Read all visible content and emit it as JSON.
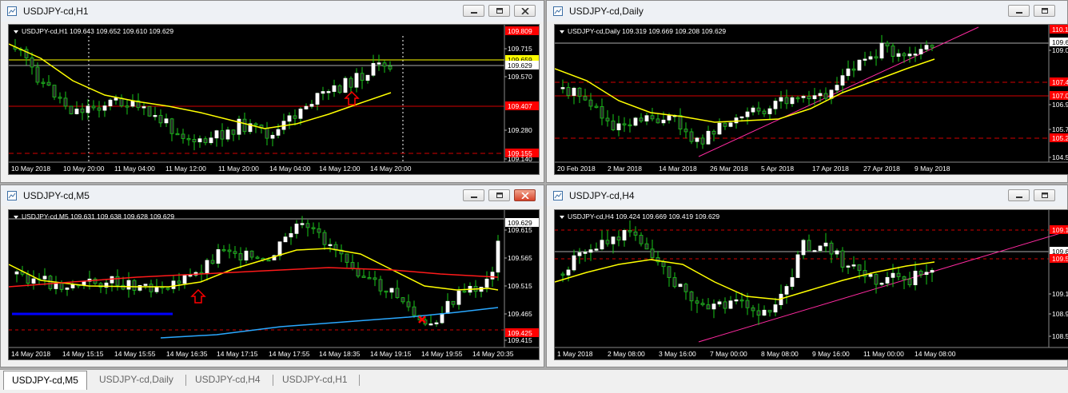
{
  "windows": [
    {
      "id": "h1",
      "title": "USDJPY-cd,H1",
      "header": "USDJPY-cd,H1  109.643 109.652 109.610 109.629",
      "price_labels": [
        {
          "text": "109.809",
          "kind": "red"
        },
        {
          "text": "109.715",
          "kind": "plain"
        },
        {
          "text": "109.659",
          "kind": "yellow"
        },
        {
          "text": "109.629",
          "kind": "white"
        },
        {
          "text": "109.570",
          "kind": "plain"
        },
        {
          "text": "109.407",
          "kind": "red"
        },
        {
          "text": "109.280",
          "kind": "plain"
        },
        {
          "text": "109.155",
          "kind": "red"
        },
        {
          "text": "109.140",
          "kind": "plain"
        }
      ],
      "time_labels": [
        "10 May 2018",
        "10 May 20:00",
        "11 May 04:00",
        "11 May 12:00",
        "11 May 20:00",
        "14 May 04:00",
        "14 May 12:00",
        "14 May 20:00"
      ]
    },
    {
      "id": "daily",
      "title": "USDJPY-cd,Daily",
      "header": "USDJPY-cd,Daily  109.319 109.669 109.208 109.629",
      "price_labels": [
        {
          "text": "110.1",
          "kind": "red"
        },
        {
          "text": "109.6",
          "kind": "white"
        },
        {
          "text": "109.0",
          "kind": "plain"
        },
        {
          "text": "107.4",
          "kind": "red"
        },
        {
          "text": "107.0",
          "kind": "red"
        },
        {
          "text": "106.9",
          "kind": "plain"
        },
        {
          "text": "105.7",
          "kind": "plain"
        },
        {
          "text": "105.2",
          "kind": "red"
        },
        {
          "text": "104.5",
          "kind": "plain"
        }
      ],
      "time_labels": [
        "20 Feb 2018",
        "2 Mar 2018",
        "14 Mar 2018",
        "26 Mar 2018",
        "5 Apr 2018",
        "17 Apr 2018",
        "27 Apr 2018",
        "9 May 2018"
      ]
    },
    {
      "id": "m5",
      "title": "USDJPY-cd,M5",
      "header": "USDJPY-cd,M5  109.631 109.638 109.628 109.629",
      "price_labels": [
        {
          "text": "109.629",
          "kind": "white"
        },
        {
          "text": "109.615",
          "kind": "plain"
        },
        {
          "text": "109.565",
          "kind": "plain"
        },
        {
          "text": "109.515",
          "kind": "plain"
        },
        {
          "text": "109.465",
          "kind": "plain"
        },
        {
          "text": "109.425",
          "kind": "red"
        },
        {
          "text": "109.415",
          "kind": "plain"
        }
      ],
      "time_labels": [
        "14 May 2018",
        "14 May 15:15",
        "14 May 15:55",
        "14 May 16:35",
        "14 May 17:15",
        "14 May 17:55",
        "14 May 18:35",
        "14 May 19:15",
        "14 May 19:55",
        "14 May 20:35"
      ]
    },
    {
      "id": "h4",
      "title": "USDJPY-cd,H4",
      "header": "USDJPY-cd,H4  109.424 109.669 109.419 109.629",
      "price_labels": [
        {
          "text": "109.1",
          "kind": "red"
        },
        {
          "text": "109.6",
          "kind": "white"
        },
        {
          "text": "109.5",
          "kind": "red"
        },
        {
          "text": "109.1",
          "kind": "plain"
        },
        {
          "text": "108.9",
          "kind": "plain"
        },
        {
          "text": "108.5",
          "kind": "plain"
        }
      ],
      "time_labels": [
        "1 May 2018",
        "2 May 08:00",
        "3 May 16:00",
        "7 May 00:00",
        "8 May 08:00",
        "9 May 16:00",
        "11 May 00:00",
        "14 May 08:00"
      ]
    }
  ],
  "tabs": [
    {
      "label": "USDJPY-cd,M5",
      "active": true
    },
    {
      "label": "USDJPY-cd,Daily",
      "active": false
    },
    {
      "label": "USDJPY-cd,H4",
      "active": false
    },
    {
      "label": "USDJPY-cd,H1",
      "active": false
    }
  ],
  "colors": {
    "up": "#ffffff",
    "down": "#2a2a2a",
    "wick": "#19c819",
    "ma_yellow": "#ffff00",
    "ma_red": "#ff1a1a",
    "ma_blue": "#2aa8ff",
    "level_red": "#d40000",
    "trend": "#ff2aa0",
    "label_red": "#ff0000"
  }
}
